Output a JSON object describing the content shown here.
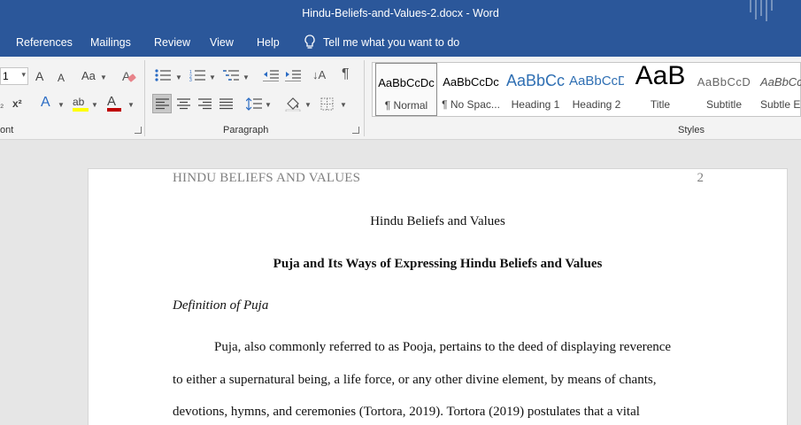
{
  "window": {
    "title": "Hindu-Beliefs-and-Values-2.docx  -  Word"
  },
  "tabs": [
    "References",
    "Mailings",
    "Review",
    "View",
    "Help"
  ],
  "tell_me": "Tell me what you want to do",
  "ribbon": {
    "font_size": "1",
    "groups": {
      "font": "ont",
      "paragraph": "Paragraph",
      "styles": "Styles"
    },
    "font_buttons": {
      "grow": "A",
      "shrink": "A",
      "case": "Aa",
      "subscript": "₂",
      "superscript": "x²",
      "effects": "A",
      "highlight": "ab",
      "font_color": "A"
    },
    "styles": [
      {
        "sample": "AaBbCcDc",
        "name": "¶ Normal"
      },
      {
        "sample": "AaBbCcDc",
        "name": "¶ No Spac..."
      },
      {
        "sample": "AaBbCc",
        "name": "Heading 1"
      },
      {
        "sample": "AaBbCcD",
        "name": "Heading 2"
      },
      {
        "sample": "AaB",
        "name": "Title"
      },
      {
        "sample": "AaBbCcD",
        "name": "Subtitle"
      },
      {
        "sample": "AaBbCcD",
        "name": "Subtle Em"
      }
    ],
    "colors": {
      "accent": "#2b579a",
      "highlight": "#ffff00",
      "font_color": "#c00000"
    }
  },
  "document": {
    "running_head": "HINDU BELIEFS AND VALUES",
    "page_number": "2",
    "title": "Hindu Beliefs and Values",
    "heading": "Puja and Its Ways of Expressing Hindu Beliefs and Values",
    "subheading": "Definition of Puja",
    "lines": [
      "Puja, also commonly referred to as Pooja, pertains to the deed of displaying reverence",
      "to either a supernatural being, a life force, or any other divine element, by means of chants,",
      "devotions, hymns, and ceremonies (Tortora, 2019). Tortora (2019) postulates that a vital"
    ]
  }
}
